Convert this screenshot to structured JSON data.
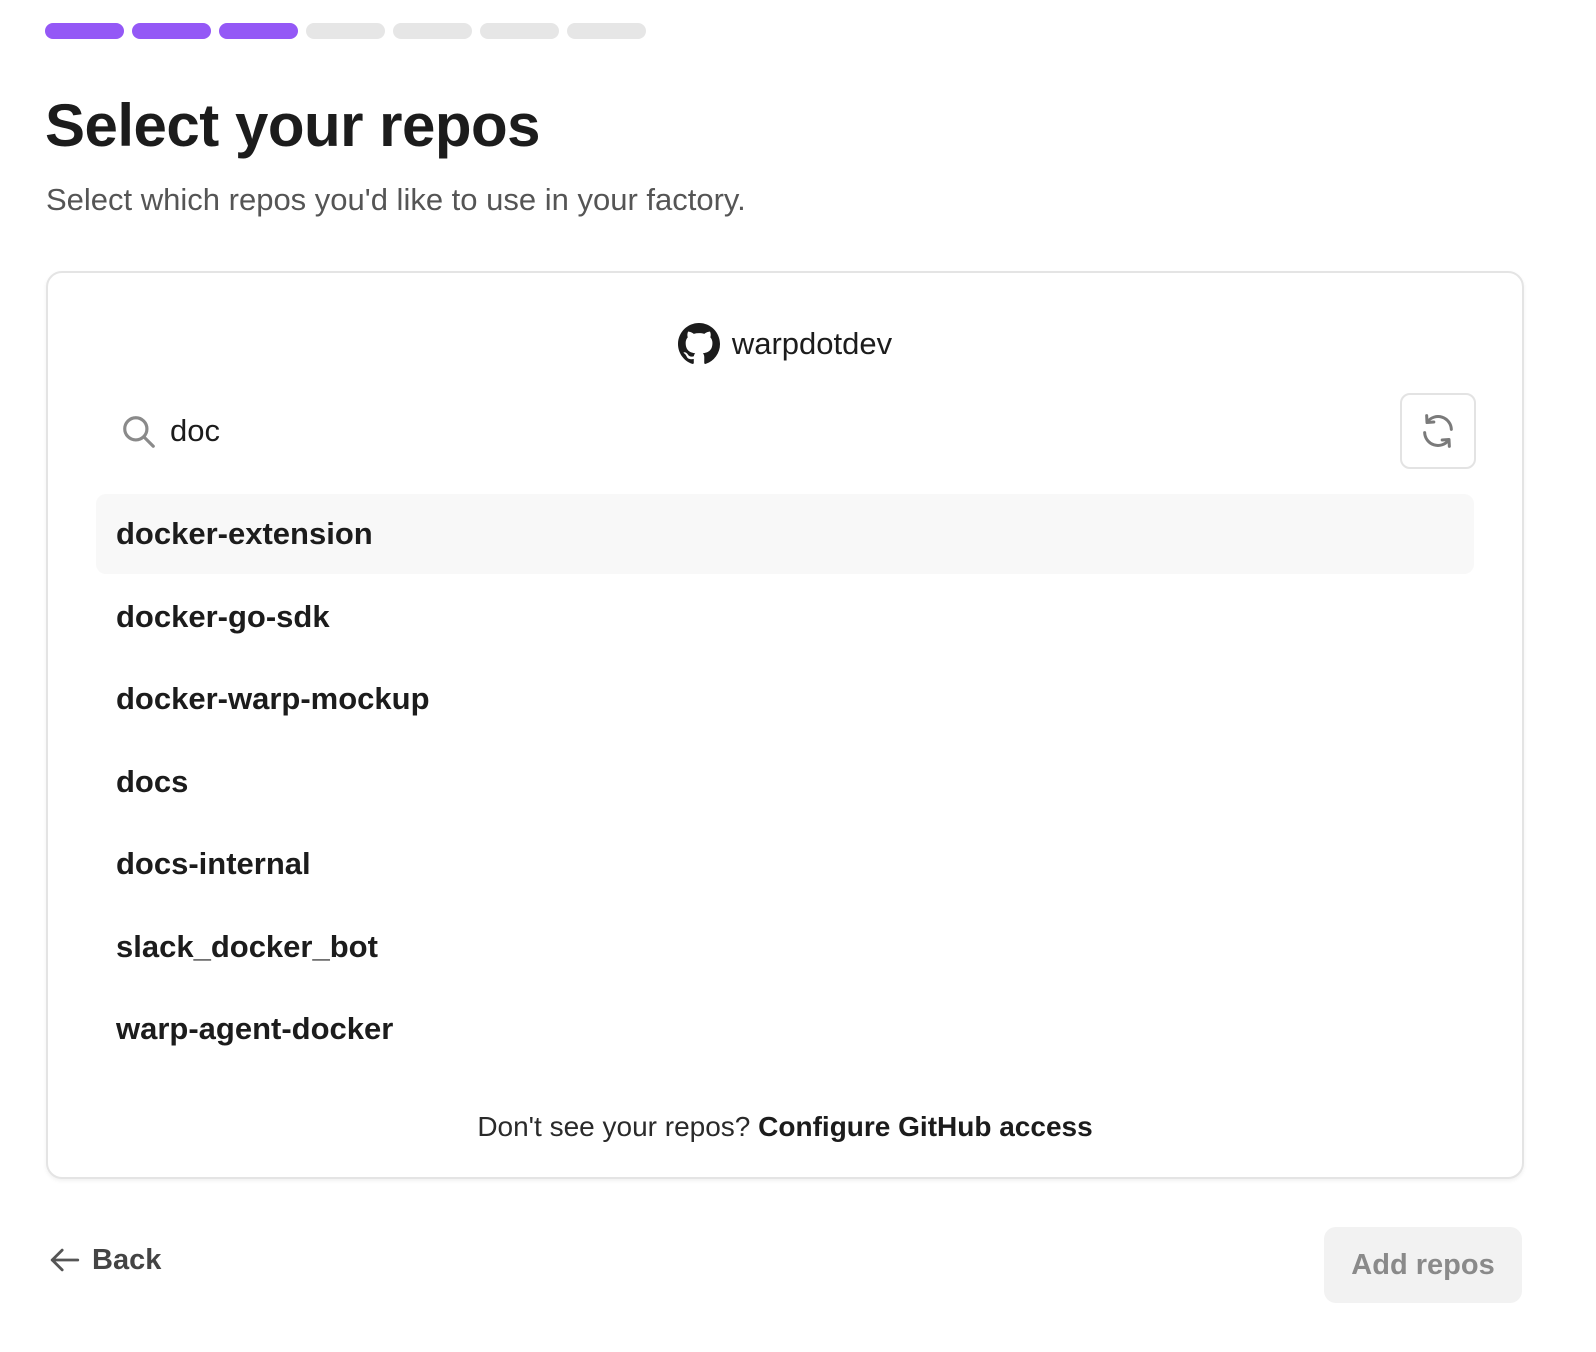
{
  "progress": {
    "completed_steps": 3,
    "total_steps": 7
  },
  "header": {
    "title": "Select your repos",
    "subtitle": "Select which repos you'd like to use in your factory."
  },
  "card": {
    "org_icon": "github-icon",
    "org_name": "warpdotdev",
    "search": {
      "icon": "search-icon",
      "value": "doc",
      "placeholder": ""
    },
    "refresh_icon": "refresh-icon",
    "repos": [
      "docker-extension",
      "docker-go-sdk",
      "docker-warp-mockup",
      "docs",
      "docs-internal",
      "slack_docker_bot",
      "warp-agent-docker"
    ],
    "highlighted_repo_index": 0,
    "footer_text": "Don't see your repos?",
    "footer_link": "Configure GitHub access"
  },
  "actions": {
    "back_icon": "arrow-left-icon",
    "back_label": "Back",
    "add_label": "Add repos"
  },
  "colors": {
    "accent": "#9458f6",
    "step_inactive": "#e6e6e6",
    "disabled_button_bg": "#f2f2f2"
  }
}
